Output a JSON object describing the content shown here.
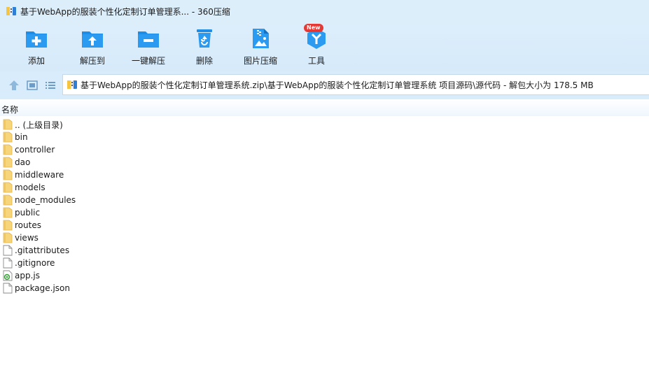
{
  "window": {
    "title": "基于WebApp的服装个性化定制订单管理系... - 360压缩"
  },
  "toolbar": {
    "items": [
      {
        "label": "添加",
        "icon": "add-folder-icon"
      },
      {
        "label": "解压到",
        "icon": "extract-to-icon"
      },
      {
        "label": "一键解压",
        "icon": "one-click-extract-icon"
      },
      {
        "label": "删除",
        "icon": "recycle-bin-icon"
      },
      {
        "label": "图片压缩",
        "icon": "image-compress-icon"
      },
      {
        "label": "工具",
        "icon": "tools-icon",
        "badge": "New"
      }
    ]
  },
  "address": {
    "path": "基于WebApp的服装个性化定制订单管理系统.zip\\基于WebApp的服装个性化定制订单管理系统 项目源码\\源代码 - 解包大小为 178.5 MB"
  },
  "columns": {
    "name": "名称"
  },
  "files": [
    {
      "name": ".. (上级目录)",
      "type": "folder"
    },
    {
      "name": "bin",
      "type": "folder"
    },
    {
      "name": "controller",
      "type": "folder"
    },
    {
      "name": "dao",
      "type": "folder"
    },
    {
      "name": "middleware",
      "type": "folder"
    },
    {
      "name": "models",
      "type": "folder"
    },
    {
      "name": "node_modules",
      "type": "folder"
    },
    {
      "name": "public",
      "type": "folder"
    },
    {
      "name": "routes",
      "type": "folder"
    },
    {
      "name": "views",
      "type": "folder"
    },
    {
      "name": ".gitattributes",
      "type": "file"
    },
    {
      "name": ".gitignore",
      "type": "file"
    },
    {
      "name": "app.js",
      "type": "js"
    },
    {
      "name": "package.json",
      "type": "file"
    }
  ],
  "colors": {
    "accent": "#1e88e5",
    "folder": "#f7d57a",
    "background": "#ddeefb"
  }
}
